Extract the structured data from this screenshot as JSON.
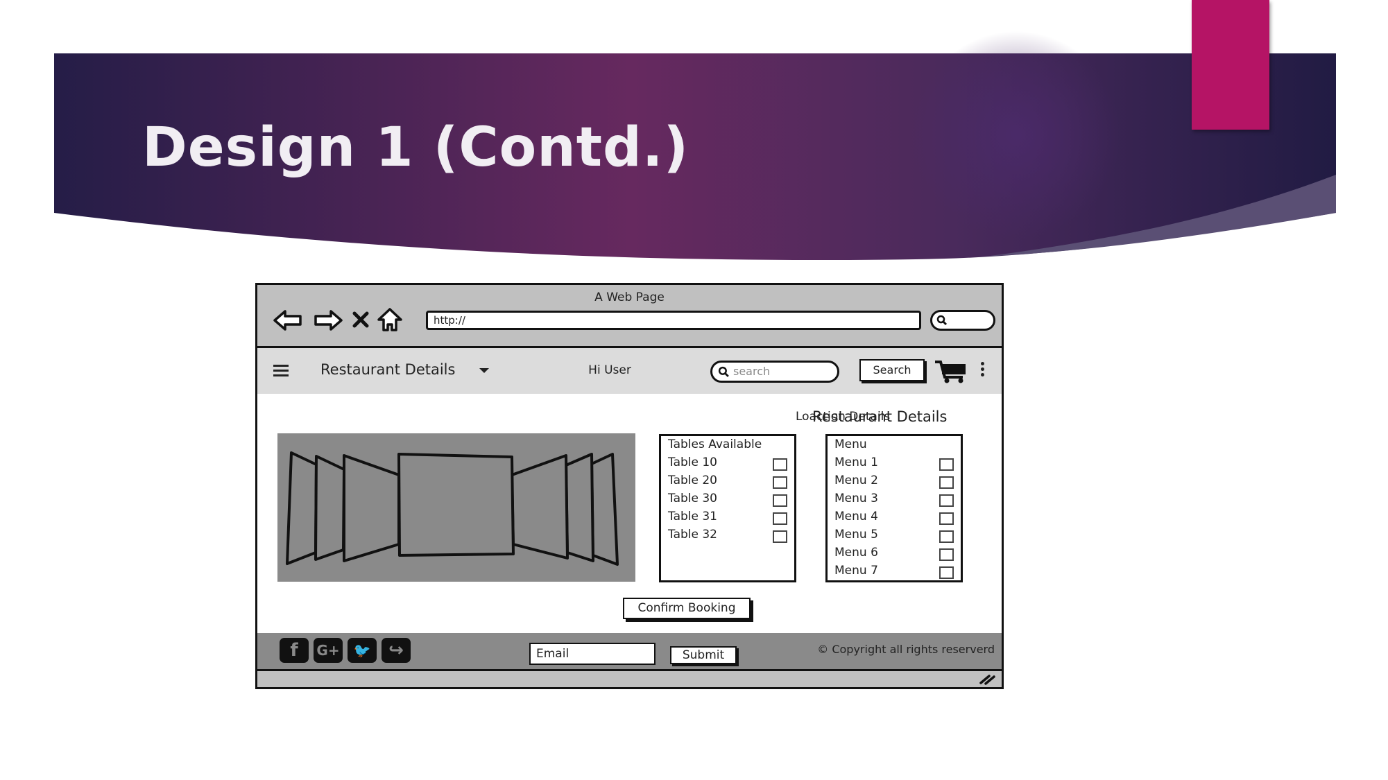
{
  "slide": {
    "title": "Design 1 (Contd.)",
    "colors": {
      "banner_dark": "#241c44",
      "banner_mid": "#6a2b62",
      "accent": "#b51465"
    }
  },
  "browser": {
    "page_title": "A Web Page",
    "url": "http://",
    "nav_icons": [
      "back-arrow-icon",
      "forward-arrow-icon",
      "close-x-icon",
      "home-icon"
    ]
  },
  "navbar": {
    "title": "Restaurant Details",
    "greeting": "Hi User",
    "search_placeholder": "search",
    "search_button": "Search"
  },
  "content": {
    "heading": "Restaurant Details",
    "location_link": "Loaction Details",
    "tables": {
      "header": "Tables Available",
      "items": [
        "Table 10",
        "Table 20",
        "Table 30",
        "Table 31",
        "Table 32"
      ]
    },
    "menu": {
      "header": "Menu",
      "items": [
        "Menu 1",
        "Menu 2",
        "Menu 3",
        "Menu 4",
        "Menu 5",
        "Menu 6",
        "Menu 7"
      ]
    },
    "confirm_button": "Confirm Booking"
  },
  "footer": {
    "social": [
      {
        "name": "facebook",
        "glyph": "f"
      },
      {
        "name": "google-plus",
        "glyph": "G+"
      },
      {
        "name": "twitter",
        "glyph": "🐦"
      },
      {
        "name": "share",
        "glyph": "↪"
      }
    ],
    "email_placeholder": "Email",
    "submit_button": "Submit",
    "copyright": "© Copyright all rights reserverd"
  }
}
